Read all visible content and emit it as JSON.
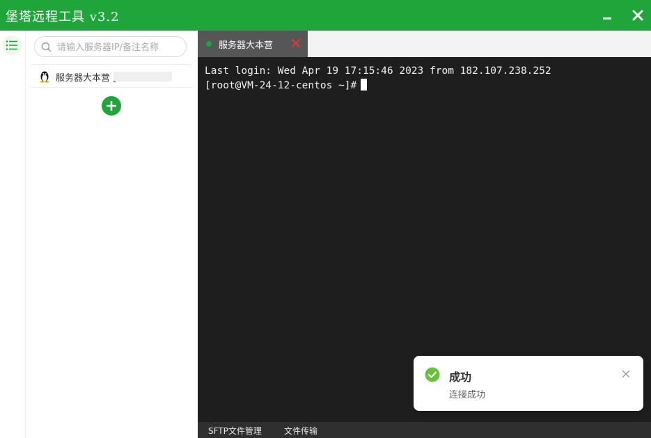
{
  "window": {
    "title": "堡塔远程工具 v3.2",
    "accent": "#20a53a",
    "minimize_icon": "minimize-icon",
    "close_icon": "close-icon"
  },
  "rail": {
    "menu_icon": "list-menu-icon"
  },
  "sidebar": {
    "search": {
      "placeholder": "请输入服务器IP/备注名称",
      "value": "",
      "icon": "search-icon"
    },
    "servers": [
      {
        "label": "服务器大本营 [",
        "os_icon": "linux-penguin-icon"
      }
    ],
    "add_icon": "plus-icon"
  },
  "tabs": [
    {
      "label": "服务器大本营",
      "status_color": "#20a53a",
      "close_icon": "close-red-icon"
    }
  ],
  "terminal": {
    "lines": [
      "Last login: Wed Apr 19 17:15:46 2023 from 182.107.238.252",
      "[root@VM-24-12-centos ~]#"
    ],
    "background": "#1e1e1e"
  },
  "bottom_tabs": [
    {
      "label": "SFTP文件管理"
    },
    {
      "label": "文件传输"
    }
  ],
  "toast": {
    "title": "成功",
    "message": "连接成功",
    "icon": "success-check-icon"
  }
}
